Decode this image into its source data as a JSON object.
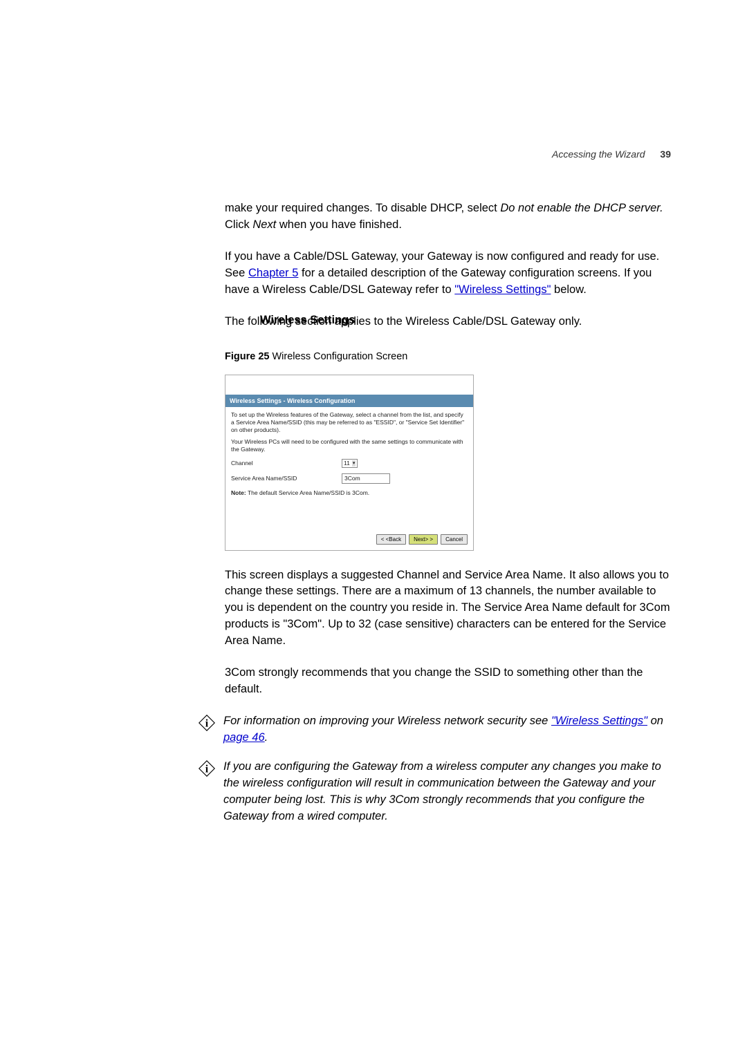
{
  "header": {
    "section_title": "Accessing the Wizard",
    "page_number": "39"
  },
  "intro": {
    "para1_a": "make your required changes. To disable DHCP, select ",
    "para1_b": "Do not enable the DHCP server.",
    "para1_c": " Click ",
    "para1_d": "Next",
    "para1_e": " when you have finished.",
    "para2_a": "If you have a Cable/DSL Gateway, your Gateway is now configured and ready for use. See ",
    "para2_link": "Chapter 5",
    "para2_b": " for a detailed description of the Gateway configuration screens. If you have a Wireless Cable/DSL Gateway refer to ",
    "para2_link2": "\"Wireless Settings\"",
    "para2_c": " below."
  },
  "wireless": {
    "label": "Wireless Settings",
    "intro": "The following section applies to the Wireless Cable/DSL Gateway only.",
    "figure_label": "Figure 25",
    "figure_title": "   Wireless Configuration Screen",
    "screenshot": {
      "title": "Wireless Settings - Wireless Configuration",
      "desc1": "To set up the Wireless features of the Gateway, select a channel from the list, and specify a Service Area Name/SSID (this may be referred to as \"ESSID\", or \"Service Set Identifier\" on other products).",
      "desc2": "Your Wireless PCs will need to be configured with the same settings to communicate with the Gateway.",
      "channel_label": "Channel",
      "channel_value": "11",
      "ssid_label": "Service Area Name/SSID",
      "ssid_value": "3Com",
      "note_label": "Note:",
      "note_text": " The default Service Area Name/SSID is 3Com.",
      "btn_back": "< <Back",
      "btn_next": "Next> >",
      "btn_cancel": "Cancel"
    },
    "body1": "This screen displays a suggested Channel and Service Area Name. It also allows you to change these settings. There are a maximum of 13 channels, the number available to you is dependent on the country you reside in. The Service Area Name default for 3Com products is \"3Com\". Up to 32 (case sensitive) characters can be entered for the Service Area Name.",
    "body2": "3Com strongly recommends that you change the SSID to something other than the default.",
    "info1_a": "For information on improving your Wireless network security see ",
    "info1_link": "\"Wireless Settings\"",
    "info1_b": " on ",
    "info1_link2": "page 46",
    "info1_c": ".",
    "info2": "If you are configuring the Gateway from a wireless computer any changes you make to the wireless configuration will result in communication between the Gateway and your computer being lost. This is why 3Com strongly recommends that you configure the Gateway from a wired computer."
  }
}
